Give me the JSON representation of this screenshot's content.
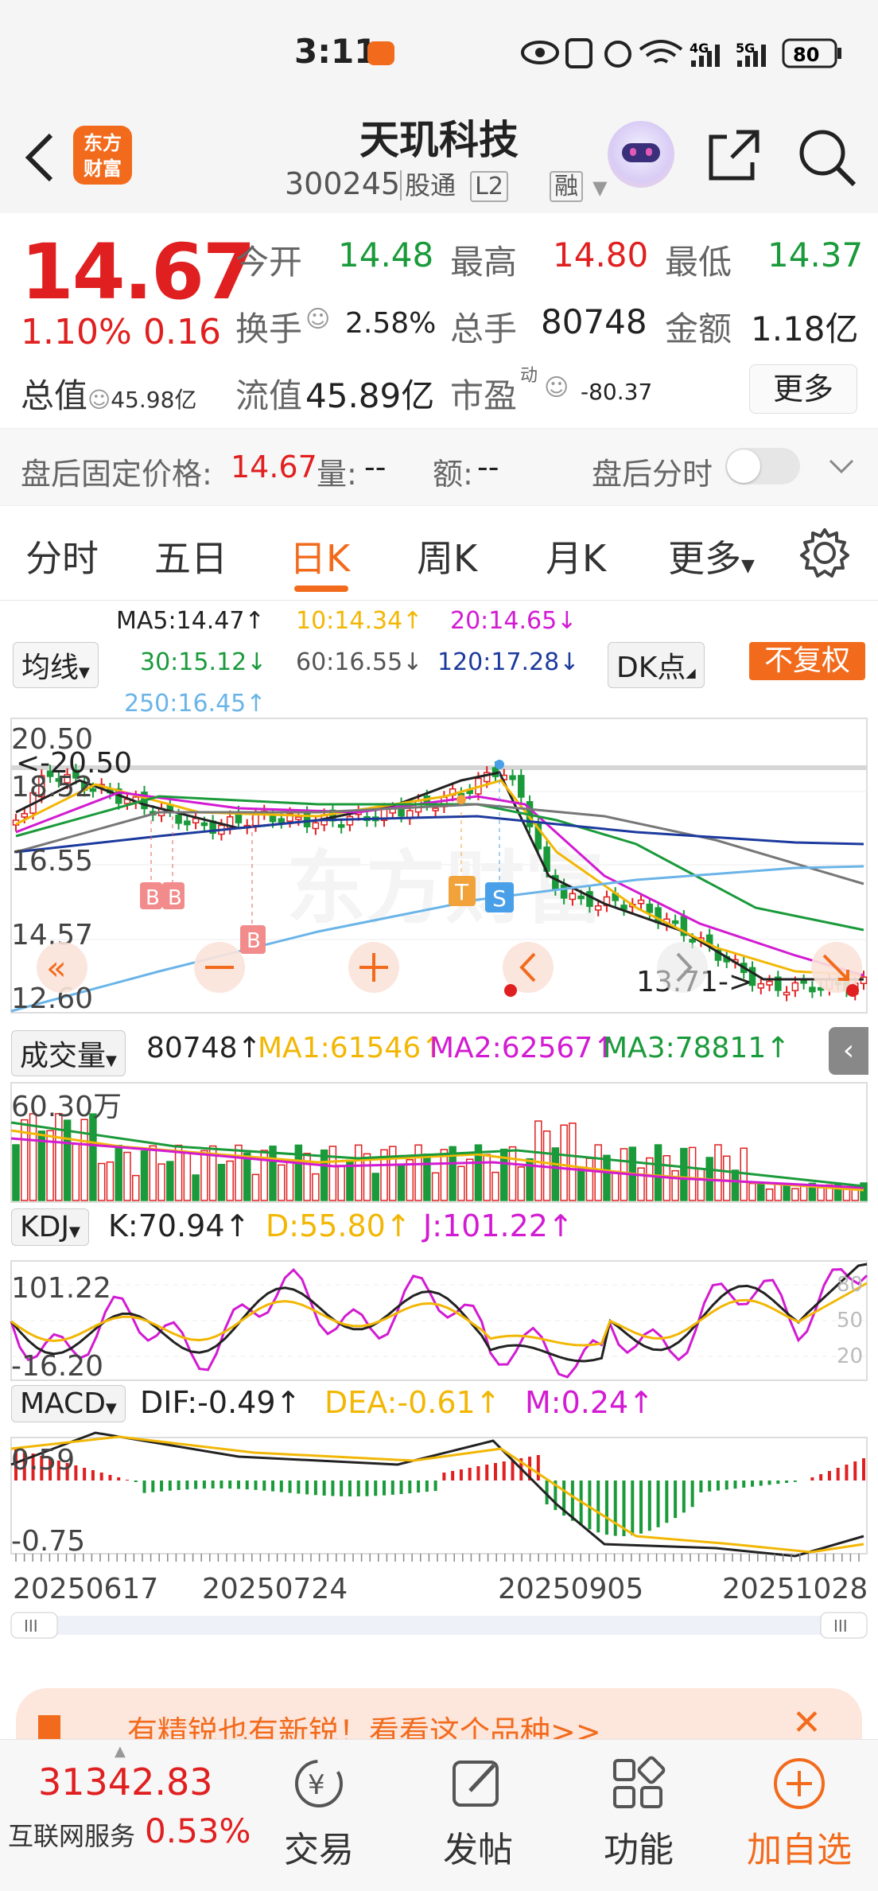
{
  "status": {
    "time": "3:11",
    "battery": "80",
    "net1": "4G",
    "net2": "5G"
  },
  "header": {
    "logo_line1": "东方",
    "logo_line2": "财富",
    "title": "天玑科技",
    "code": "300245",
    "tag1": "股通",
    "tag2": "L2",
    "tag3": "融"
  },
  "quote": {
    "price": "14.67",
    "change_pct": "1.10%",
    "change": "0.16",
    "open_label": "今开",
    "open": "14.48",
    "high_label": "最高",
    "high": "14.80",
    "low_label": "最低",
    "low": "14.37",
    "turnover_label": "换手",
    "turnover": "2.58%",
    "volume_label": "总手",
    "volume": "80748",
    "amount_label": "金额",
    "amount": "1.18亿",
    "mcap_label": "总值",
    "mcap": "45.98亿",
    "float_label": "流值",
    "float": "45.89亿",
    "pe_label": "市盈",
    "pe_sup": "动",
    "pe": "-80.37",
    "more": "更多"
  },
  "afterhours": {
    "price_label": "盘后固定价格:",
    "price": "14.67",
    "vol_label": "量:",
    "vol": "--",
    "amt_label": "额:",
    "amt": "--",
    "timeshare_label": "盘后分时"
  },
  "tabs": [
    "分时",
    "五日",
    "日K",
    "周K",
    "月K",
    "更多"
  ],
  "ma": {
    "selector": "均线",
    "ma5": "MA5:14.47↑",
    "ma10": "10:14.34↑",
    "ma20": "20:14.65↓",
    "ma30": "30:15.12↓",
    "ma60": "60:16.55↓",
    "ma120": "120:17.28↓",
    "ma250": "250:16.45↑",
    "dk": "DK点",
    "adjust": "不复权"
  },
  "kline": {
    "ylabels": [
      "20.50",
      "18.52",
      "16.55",
      "14.57",
      "12.60"
    ],
    "max_label": "<-20.50",
    "min_label": "13.71->",
    "markers": [
      "B",
      "B",
      "B",
      "T",
      "S"
    ],
    "watermark": "东方财富"
  },
  "volume": {
    "selector": "成交量",
    "value": "80748↑",
    "ma1": "MA1:61546↑",
    "ma2": "MA2:62567↑",
    "ma3": "MA3:78811↑",
    "ylabel": "60.30万"
  },
  "kdj": {
    "selector": "KDJ",
    "k": "K:70.94↑",
    "d": "D:55.80↑",
    "j": "J:101.22↑",
    "ymax": "101.22",
    "ymin": "-16.20",
    "r80": "80",
    "r50": "50",
    "r20": "20"
  },
  "macd": {
    "selector": "MACD",
    "dif": "DIF:-0.49↑",
    "dea": "DEA:-0.61↑",
    "m": "M:0.24↑",
    "ymax": "0.59",
    "ymin": "-0.75"
  },
  "dates": [
    "20250617",
    "20250724",
    "20250905",
    "20251028"
  ],
  "banner": {
    "text": "有精锐也有新锐！看看这个品种>>"
  },
  "bottom": {
    "index_value": "31342.83",
    "index_name": "互联网服务",
    "index_change": "0.53%",
    "trade": "交易",
    "post": "发帖",
    "func": "功能",
    "watch": "加自选"
  },
  "colors": {
    "up": "#e02020",
    "down": "#1a9a3a",
    "accent": "#f26b1d",
    "ma5": "#222222",
    "ma10": "#f2b705",
    "ma20": "#d21bd2",
    "ma30": "#1a9a3a",
    "ma60": "#777777",
    "ma120": "#1c3a9e",
    "ma250": "#6ab4e8"
  }
}
